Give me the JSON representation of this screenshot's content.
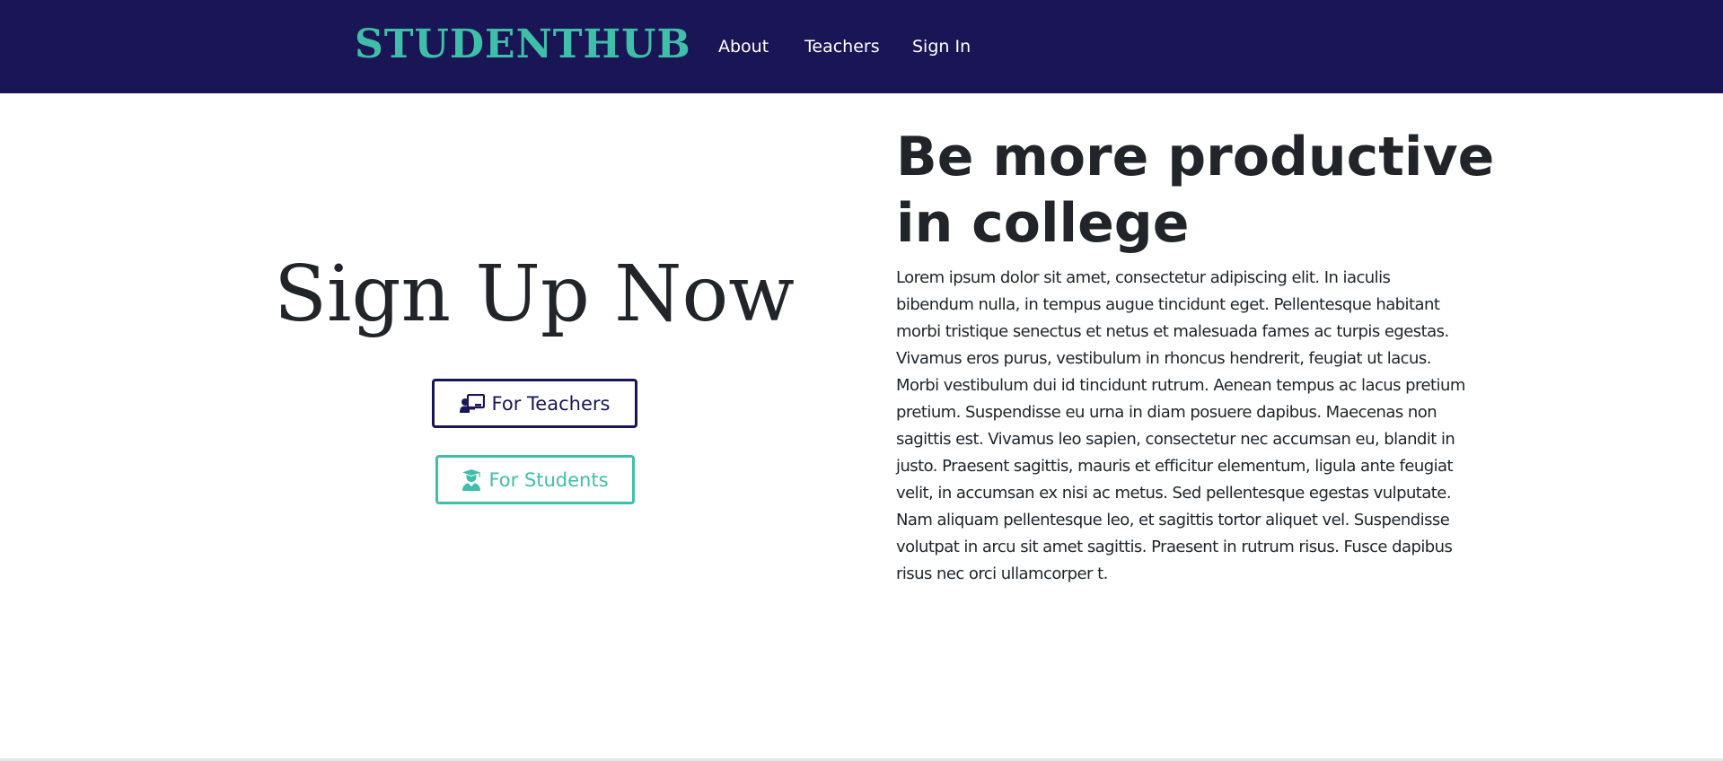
{
  "nav": {
    "brand": "STUDENTHUB",
    "links": [
      "About",
      "Teachers",
      "Sign In"
    ]
  },
  "signup": {
    "title": "Sign Up Now",
    "teachers_button": "For Teachers",
    "students_button": "For Students",
    "teachers_icon": "chalkboard-teacher-icon",
    "students_icon": "user-graduate-icon"
  },
  "hero": {
    "title_line1": "Be more productive",
    "title_line2": "in college",
    "body": "Lorem ipsum dolor sit amet, consectetur adipiscing elit. In iaculis bibendum nulla, in tempus augue tincidunt eget. Pellentesque habitant morbi tristique senectus et netus et malesuada fames ac turpis egestas. Vivamus eros purus, vestibulum in rhoncus hendrerit, feugiat ut lacus. Morbi vestibulum dui id tincidunt rutrum. Aenean tempus ac lacus pretium pretium. Suspendisse eu urna in diam posuere dapibus. Maecenas non sagittis est. Vivamus leo sapien, consectetur nec accumsan eu, blandit in justo. Praesent sagittis, mauris et efficitur elementum, ligula ante feugiat velit, in accumsan ex nisi ac metus. Sed pellentesque egestas vulputate. Nam aliquam pellentesque leo, et sagittis tortor aliquet vel. Suspendisse volutpat in arcu sit amet sagittis. Praesent in rutrum risus. Fusce dapibus risus nec orci ullamcorper t."
  },
  "colors": {
    "navbar": "#1a1656",
    "accent": "#3fbfa9",
    "text": "#212529"
  }
}
